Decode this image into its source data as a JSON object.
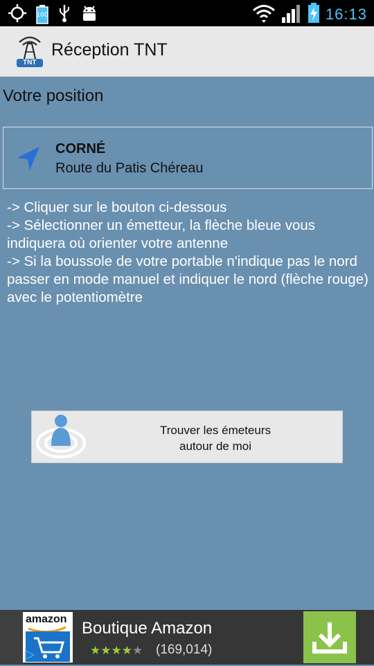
{
  "status_bar": {
    "battery_small_label": "100",
    "time": "16:13",
    "icons": [
      "gps-icon",
      "battery-saver-icon",
      "usb-icon",
      "android-debug-icon",
      "wifi-icon",
      "signal-icon",
      "battery-charging-icon"
    ]
  },
  "action_bar": {
    "title": "Réception TNT",
    "logo_text": "TNT"
  },
  "position": {
    "section_title": "Votre position",
    "city": "CORNÉ",
    "street": "Route du Patis Chéreau"
  },
  "instructions": [
    "-> Cliquer sur le bouton ci-dessous",
    "-> Sélectionner un émetteur, la flèche bleue vous indiquera où orienter votre antenne",
    "-> Si la boussole de votre portable n'indique pas le nord  passer en mode manuel et indiquer le nord (flèche rouge) avec le potentiomètre"
  ],
  "find_button": {
    "line1": "Trouver les émeteurs",
    "line2": "autour de moi"
  },
  "ad": {
    "logo_text": "amazon",
    "title": "Boutique Amazon",
    "rating": 4,
    "rating_max": 5,
    "rating_count": "(169,014)"
  },
  "colors": {
    "background": "#6a90b0",
    "accent": "#4fc3f7",
    "navigation_arrow": "#2a6fd6",
    "ad_download": "#8bc34a"
  }
}
